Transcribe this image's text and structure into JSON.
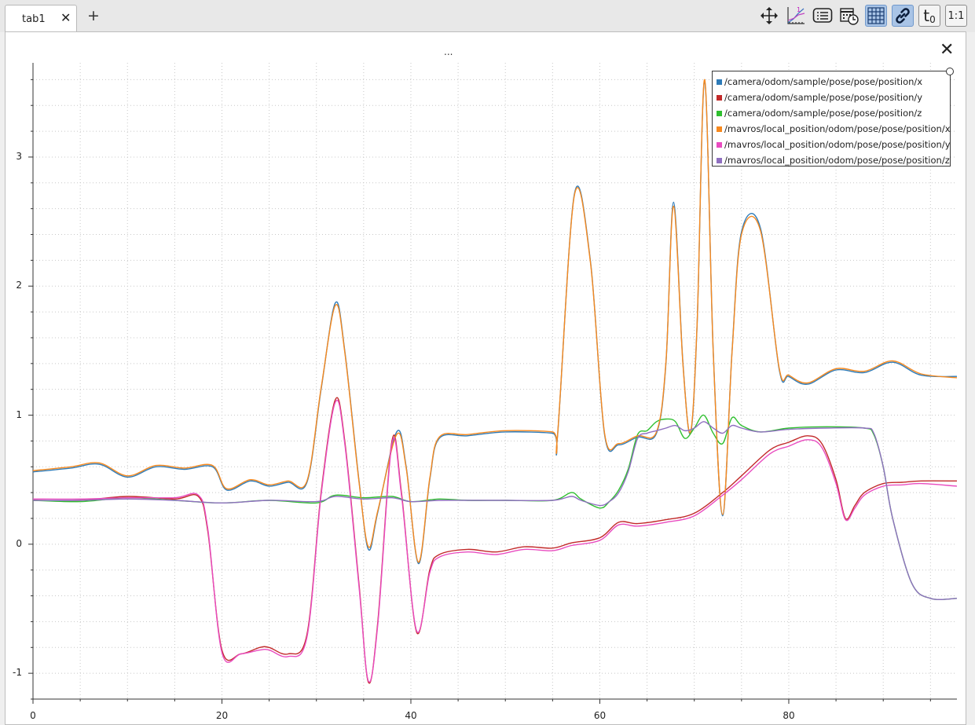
{
  "tab": {
    "label": "tab1"
  },
  "panel": {
    "title": "..."
  },
  "colors": {
    "cam_x": "#2e7bb8",
    "cam_y": "#c22a2a",
    "cam_z": "#2fbf2f",
    "mav_x": "#f7891e",
    "mav_y": "#e94cc0",
    "mav_z": "#8f6fc0"
  },
  "toolbar": {
    "icons": [
      "move-icon",
      "ruler-icon",
      "list-icon",
      "calendar-clock-icon",
      "grid-icon",
      "link-icon",
      "t0-icon",
      "ratio-icon"
    ],
    "t0_label": "t",
    "t0_sub": "0",
    "ratio_label": "1:1"
  },
  "chart_data": {
    "type": "line",
    "title": "",
    "xlabel": "",
    "ylabel": "",
    "xlim": [
      0,
      97.8
    ],
    "ylim": [
      -1.2,
      3.73
    ],
    "grid": true,
    "legend": "top-right",
    "xticks": [
      0,
      20,
      40,
      60,
      80
    ],
    "yticks": [
      -1,
      0,
      1,
      2,
      3
    ],
    "series": [
      {
        "name": "/camera/odom/sample/pose/pose/position/x",
        "color": "#2e7bb8",
        "x": [
          0,
          4,
          7,
          10,
          13,
          16,
          19,
          20.5,
          23,
          25,
          27,
          29,
          30.5,
          32,
          33,
          34.5,
          35.5,
          36.5,
          38.5,
          39.5,
          40.8,
          42,
          43,
          46,
          50,
          55,
          55.5,
          57.3,
          59,
          60.5,
          62,
          64,
          66,
          67,
          67.8,
          68.8,
          69.6,
          70.3,
          71.1,
          72,
          73,
          74,
          75,
          77,
          79,
          80,
          82,
          85,
          88,
          91,
          94,
          97.8
        ],
        "y": [
          0.56,
          0.59,
          0.62,
          0.52,
          0.6,
          0.58,
          0.6,
          0.42,
          0.49,
          0.45,
          0.48,
          0.48,
          1.2,
          1.87,
          1.5,
          0.5,
          -0.04,
          0.25,
          0.87,
          0.6,
          -0.15,
          0.5,
          0.82,
          0.84,
          0.87,
          0.86,
          0.82,
          2.71,
          2.2,
          0.85,
          0.77,
          0.83,
          0.86,
          1.4,
          2.65,
          1.4,
          0.86,
          1.7,
          3.59,
          1.5,
          0.22,
          1.5,
          2.42,
          2.45,
          1.35,
          1.3,
          1.24,
          1.35,
          1.33,
          1.41,
          1.31,
          1.3
        ]
      },
      {
        "name": "/camera/odom/sample/pose/pose/position/y",
        "color": "#c22a2a",
        "x": [
          0,
          5,
          10,
          15,
          17.5,
          18.5,
          20,
          22,
          24,
          25,
          27,
          29,
          30.5,
          32,
          33,
          34.5,
          35.5,
          36.5,
          38,
          39,
          40.6,
          42,
          43,
          46,
          49,
          52,
          55,
          57,
          60,
          62,
          64,
          67,
          70,
          73,
          75,
          78,
          80,
          82,
          83.5,
          85,
          86,
          87,
          88,
          90,
          92,
          94,
          97.8
        ],
        "y": [
          0.34,
          0.34,
          0.37,
          0.35,
          0.37,
          0.1,
          -0.82,
          -0.85,
          -0.8,
          -0.8,
          -0.85,
          -0.7,
          0.4,
          1.12,
          0.8,
          -0.3,
          -1.07,
          -0.6,
          0.8,
          0.4,
          -0.68,
          -0.2,
          -0.08,
          -0.04,
          -0.06,
          -0.02,
          -0.03,
          0.01,
          0.05,
          0.17,
          0.16,
          0.19,
          0.24,
          0.4,
          0.53,
          0.73,
          0.79,
          0.84,
          0.78,
          0.5,
          0.2,
          0.3,
          0.4,
          0.47,
          0.48,
          0.49,
          0.49
        ]
      },
      {
        "name": "/camera/odom/sample/pose/pose/position/z",
        "color": "#2fbf2f",
        "x": [
          0,
          5,
          10,
          15,
          20,
          25,
          30,
          32,
          35,
          38,
          40,
          43,
          46,
          50,
          55,
          57,
          58,
          60,
          61,
          62,
          63,
          64,
          65,
          66,
          67,
          68,
          69,
          70,
          71,
          72,
          73,
          74,
          75,
          77,
          80,
          84,
          88,
          89,
          90,
          91,
          93,
          95,
          97.8
        ],
        "y": [
          0.34,
          0.33,
          0.36,
          0.34,
          0.32,
          0.34,
          0.32,
          0.38,
          0.36,
          0.37,
          0.33,
          0.35,
          0.34,
          0.34,
          0.34,
          0.4,
          0.35,
          0.28,
          0.33,
          0.42,
          0.58,
          0.85,
          0.88,
          0.95,
          0.97,
          0.95,
          0.82,
          0.9,
          1.0,
          0.86,
          0.78,
          0.98,
          0.92,
          0.87,
          0.9,
          0.91,
          0.9,
          0.85,
          0.6,
          0.2,
          -0.3,
          -0.42,
          -0.42
        ]
      },
      {
        "name": "/mavros/local_position/odom/pose/pose/position/x",
        "color": "#f7891e",
        "x": [
          0,
          4,
          7,
          10,
          13,
          16,
          19,
          20.5,
          23,
          25,
          27,
          29,
          30.5,
          32,
          33,
          34.5,
          35.5,
          36.5,
          38.5,
          39.5,
          40.8,
          42,
          43,
          46,
          50,
          55,
          55.5,
          57.3,
          59,
          60.5,
          62,
          64,
          66,
          67,
          67.8,
          68.8,
          69.6,
          70.3,
          71.1,
          72,
          73,
          74,
          75,
          77,
          79,
          80,
          82,
          85,
          88,
          91,
          94,
          97.8
        ],
        "y": [
          0.57,
          0.6,
          0.63,
          0.53,
          0.61,
          0.59,
          0.61,
          0.43,
          0.5,
          0.46,
          0.49,
          0.49,
          1.21,
          1.85,
          1.49,
          0.49,
          -0.02,
          0.26,
          0.85,
          0.59,
          -0.14,
          0.51,
          0.83,
          0.85,
          0.88,
          0.87,
          0.83,
          2.7,
          2.19,
          0.86,
          0.78,
          0.84,
          0.87,
          1.41,
          2.62,
          1.39,
          0.87,
          1.71,
          3.6,
          1.49,
          0.23,
          1.49,
          2.4,
          2.43,
          1.36,
          1.31,
          1.25,
          1.36,
          1.34,
          1.42,
          1.32,
          1.29
        ]
      },
      {
        "name": "/mavros/local_position/odom/pose/pose/position/y",
        "color": "#e94cc0",
        "x": [
          0,
          5,
          10,
          15,
          17.5,
          18.5,
          20,
          22,
          24,
          25,
          27,
          29,
          30.5,
          32,
          33,
          34.5,
          35.5,
          36.5,
          38,
          39,
          40.6,
          42,
          43,
          46,
          49,
          52,
          55,
          57,
          60,
          62,
          64,
          67,
          70,
          73,
          75,
          78,
          80,
          82,
          83.5,
          85,
          86,
          87,
          88,
          90,
          92,
          94,
          97.8
        ],
        "y": [
          0.35,
          0.35,
          0.36,
          0.36,
          0.38,
          0.12,
          -0.84,
          -0.85,
          -0.82,
          -0.82,
          -0.87,
          -0.72,
          0.38,
          1.1,
          0.78,
          -0.32,
          -1.06,
          -0.62,
          0.78,
          0.38,
          -0.67,
          -0.22,
          -0.1,
          -0.06,
          -0.08,
          -0.04,
          -0.05,
          -0.01,
          0.03,
          0.15,
          0.14,
          0.17,
          0.22,
          0.38,
          0.5,
          0.7,
          0.76,
          0.81,
          0.75,
          0.47,
          0.19,
          0.28,
          0.38,
          0.45,
          0.46,
          0.47,
          0.45
        ]
      },
      {
        "name": "/mavros/local_position/odom/pose/pose/position/z",
        "color": "#8f6fc0",
        "x": [
          0,
          5,
          10,
          15,
          20,
          25,
          30,
          32,
          35,
          38,
          40,
          43,
          46,
          50,
          55,
          57,
          58,
          60,
          61,
          62,
          63,
          64,
          65,
          66,
          67,
          68,
          69,
          70,
          71,
          72,
          73,
          74,
          75,
          77,
          80,
          84,
          88,
          89,
          90,
          91,
          93,
          95,
          97.8
        ],
        "y": [
          0.34,
          0.34,
          0.35,
          0.34,
          0.32,
          0.34,
          0.33,
          0.37,
          0.35,
          0.36,
          0.33,
          0.34,
          0.34,
          0.34,
          0.34,
          0.37,
          0.34,
          0.3,
          0.33,
          0.4,
          0.56,
          0.82,
          0.86,
          0.88,
          0.9,
          0.92,
          0.88,
          0.9,
          0.95,
          0.9,
          0.86,
          0.92,
          0.9,
          0.87,
          0.89,
          0.9,
          0.9,
          0.86,
          0.6,
          0.2,
          -0.3,
          -0.42,
          -0.42
        ]
      }
    ]
  }
}
